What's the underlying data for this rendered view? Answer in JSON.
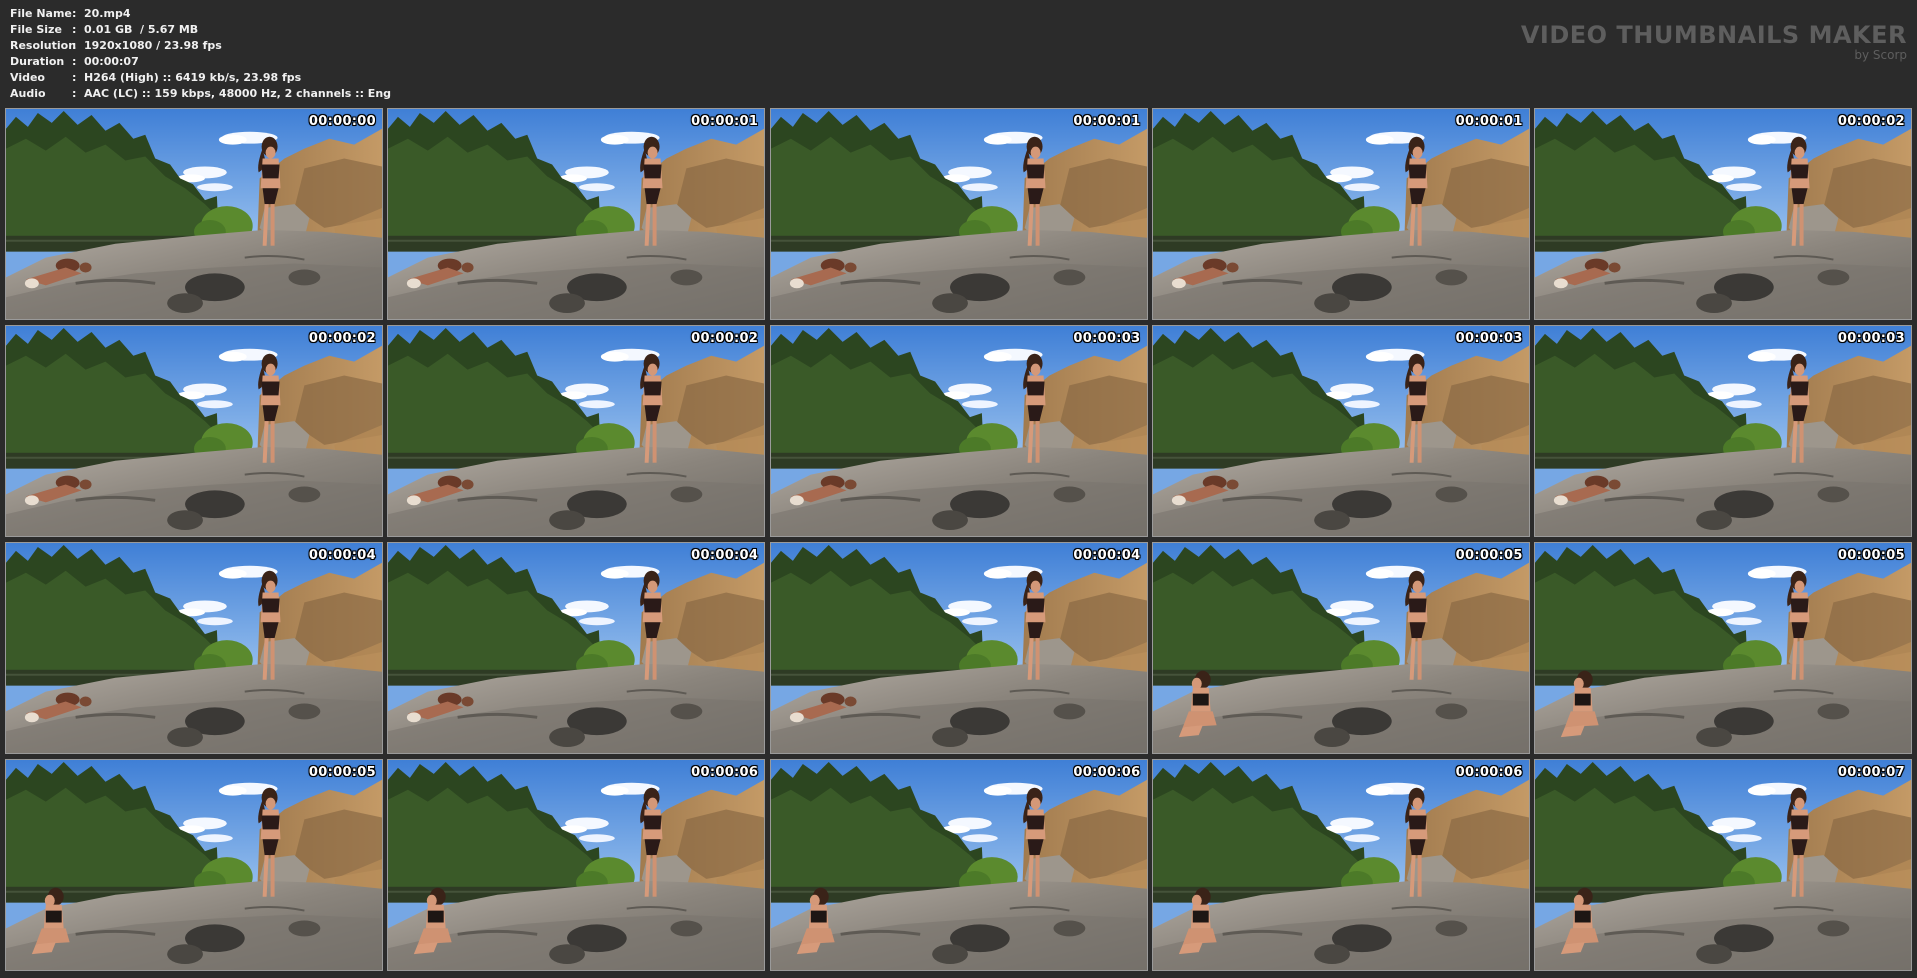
{
  "info": [
    {
      "label": "File Name",
      "value": "20.mp4"
    },
    {
      "label": "File Size",
      "value": "0.01 GB  / 5.67 MB"
    },
    {
      "label": "Resolution",
      "value": "1920x1080 / 23.98 fps"
    },
    {
      "label": "Duration",
      "value": "00:00:07"
    },
    {
      "label": "Video",
      "value": "H264 (High) :: 6419 kb/s, 23.98 fps"
    },
    {
      "label": "Audio",
      "value": "AAC (LC) :: 159 kbps, 48000 Hz, 2 channels :: Eng"
    }
  ],
  "info_separator": ":",
  "watermark": {
    "title": "VIDEO THUMBNAILS MAKER",
    "subtitle": "by Scorp"
  },
  "thumbnails": [
    {
      "timecode": "00:00:00",
      "pose": "lying"
    },
    {
      "timecode": "00:00:01",
      "pose": "lying"
    },
    {
      "timecode": "00:00:01",
      "pose": "lying"
    },
    {
      "timecode": "00:00:01",
      "pose": "lying"
    },
    {
      "timecode": "00:00:02",
      "pose": "lying"
    },
    {
      "timecode": "00:00:02",
      "pose": "lying"
    },
    {
      "timecode": "00:00:02",
      "pose": "lying"
    },
    {
      "timecode": "00:00:03",
      "pose": "lying"
    },
    {
      "timecode": "00:00:03",
      "pose": "lying"
    },
    {
      "timecode": "00:00:03",
      "pose": "lying"
    },
    {
      "timecode": "00:00:04",
      "pose": "lying"
    },
    {
      "timecode": "00:00:04",
      "pose": "lying"
    },
    {
      "timecode": "00:00:04",
      "pose": "lying"
    },
    {
      "timecode": "00:00:05",
      "pose": "sitting"
    },
    {
      "timecode": "00:00:05",
      "pose": "sitting"
    },
    {
      "timecode": "00:00:05",
      "pose": "sitting"
    },
    {
      "timecode": "00:00:06",
      "pose": "sitting"
    },
    {
      "timecode": "00:00:06",
      "pose": "sitting"
    },
    {
      "timecode": "00:00:06",
      "pose": "sitting"
    },
    {
      "timecode": "00:00:07",
      "pose": "sitting"
    }
  ],
  "colors": {
    "background": "#2b2b2b",
    "text": "#f0f0f0",
    "watermark": "#5e5e5e",
    "sky": "#6fa2e6",
    "trees": "#2f4a22",
    "rock": "#8f8a84",
    "dry_grass": "#b08a5c",
    "water": "#3a4a2f"
  }
}
